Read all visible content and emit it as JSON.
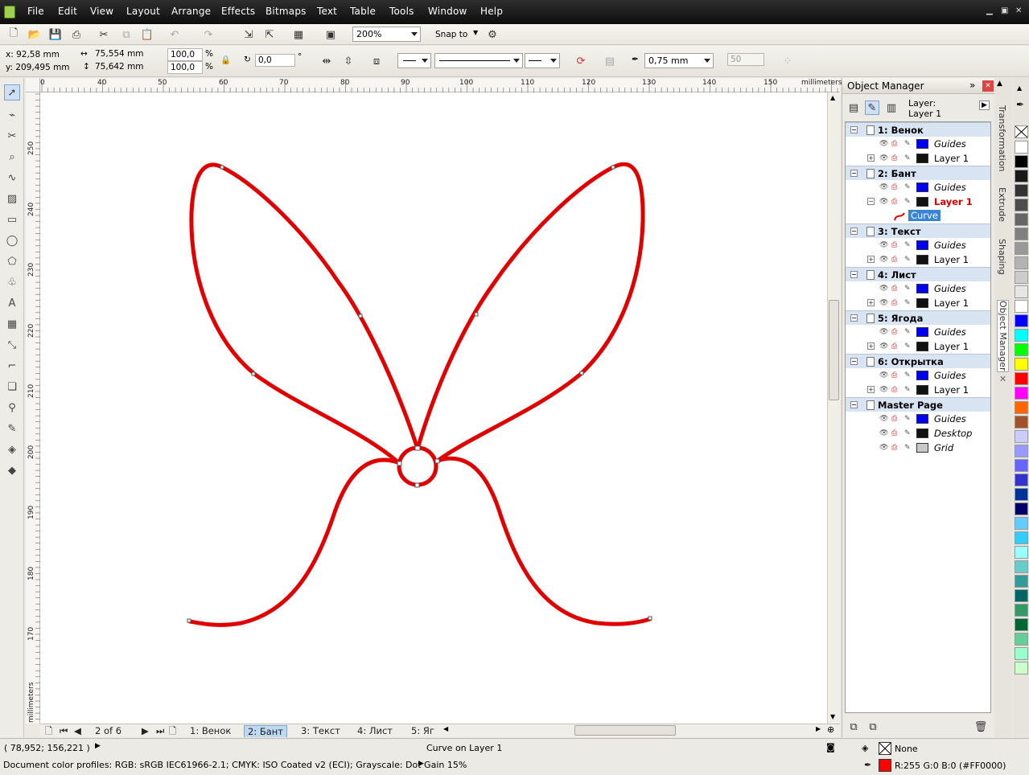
{
  "menu": [
    "File",
    "Edit",
    "View",
    "Layout",
    "Arrange",
    "Effects",
    "Bitmaps",
    "Text",
    "Table",
    "Tools",
    "Window",
    "Help"
  ],
  "toolbar": {
    "zoom": "200%",
    "snap_to": "Snap to"
  },
  "props": {
    "x": "x: 92,58 mm",
    "y": "y: 209,495 mm",
    "w": "75,554 mm",
    "h": "75,642 mm",
    "sx": "100,0",
    "sy": "100,0",
    "pct": "%",
    "angle": "0,0",
    "deg": "°",
    "outline": "0,75 mm",
    "nodes": "50"
  },
  "ruler": {
    "unit": "millimeters",
    "h": [
      "0",
      "40",
      "50",
      "60",
      "70",
      "80",
      "90",
      "100",
      "110",
      "120",
      "130",
      "140",
      "150"
    ],
    "v": [
      "250",
      "240",
      "230",
      "220",
      "210",
      "200",
      "190",
      "180",
      "170"
    ]
  },
  "pages": {
    "counter": "2 of 6",
    "tabs": [
      "1: Венок",
      "2: Бант",
      "3: Текст",
      "4: Лист",
      "5: Яг"
    ]
  },
  "docker": {
    "title": "Object Manager",
    "layer_label": "Layer:",
    "layer_value": "Layer 1",
    "rows": [
      {
        "type": "page",
        "label": "1: Венок"
      },
      {
        "type": "layer",
        "label": "Guides",
        "color": "#0000ee",
        "italic": true
      },
      {
        "type": "layer",
        "label": "Layer 1",
        "color": "#111111",
        "italic": false,
        "plus": true
      },
      {
        "type": "page",
        "label": "2: Бант"
      },
      {
        "type": "layer",
        "label": "Guides",
        "color": "#0000ee",
        "italic": true
      },
      {
        "type": "layer",
        "label": "Layer 1",
        "color": "#111111",
        "italic": false,
        "active": true
      },
      {
        "type": "object",
        "label": "Curve"
      },
      {
        "type": "page",
        "label": "3: Текст"
      },
      {
        "type": "layer",
        "label": "Guides",
        "color": "#0000ee",
        "italic": true
      },
      {
        "type": "layer",
        "label": "Layer 1",
        "color": "#111111",
        "italic": false,
        "plus": true
      },
      {
        "type": "page",
        "label": "4: Лист"
      },
      {
        "type": "layer",
        "label": "Guides",
        "color": "#0000ee",
        "italic": true
      },
      {
        "type": "layer",
        "label": "Layer 1",
        "color": "#111111",
        "italic": false,
        "plus": true
      },
      {
        "type": "page",
        "label": "5: Ягода"
      },
      {
        "type": "layer",
        "label": "Guides",
        "color": "#0000ee",
        "italic": true
      },
      {
        "type": "layer",
        "label": "Layer 1",
        "color": "#111111",
        "italic": false,
        "plus": true
      },
      {
        "type": "page",
        "label": "6: Открытка"
      },
      {
        "type": "layer",
        "label": "Guides",
        "color": "#0000ee",
        "italic": true
      },
      {
        "type": "layer",
        "label": "Layer 1",
        "color": "#111111",
        "italic": false,
        "plus": true
      },
      {
        "type": "page",
        "label": "Master Page"
      },
      {
        "type": "layer",
        "label": "Guides",
        "color": "#0000ee",
        "italic": true
      },
      {
        "type": "layer",
        "label": "Desktop",
        "color": "#111111",
        "italic": true
      },
      {
        "type": "layer",
        "label": "Grid",
        "color": "#c8c8c8",
        "italic": true
      }
    ]
  },
  "side_tabs": [
    "Transformation",
    "Extrude",
    "Shaping",
    "Object Manager"
  ],
  "palette": [
    "#ffffff",
    "#000000",
    "#1a1a1a",
    "#333333",
    "#4d4d4d",
    "#666666",
    "#808080",
    "#999999",
    "#b3b3b3",
    "#cccccc",
    "#e6e6e6",
    "#ffffff",
    "#0000ff",
    "#00ffff",
    "#00ff00",
    "#ffff00",
    "#ff0000",
    "#ff00ff",
    "#ff6600",
    "#a0522d",
    "#ccccff",
    "#9999ff",
    "#6666ff",
    "#3333cc",
    "#003399",
    "#000066",
    "#66ccff",
    "#33ccff",
    "#99ffff",
    "#66cccc",
    "#339999",
    "#006666",
    "#339966",
    "#006633",
    "#66cc99",
    "#99ffcc",
    "#ccffcc"
  ],
  "status": {
    "coords": "( 78,952; 156,221 )",
    "object_info": "Curve on Layer 1",
    "profiles": "Document color profiles: RGB: sRGB IEC61966-2.1; CMYK: ISO Coated v2 (ECI); Grayscale: Dot Gain 15%",
    "fill": "None",
    "outline_color": "R:255 G:0 B:0 (#FF0000)",
    "outline_hex": "#ff0000"
  },
  "drawing": {
    "stroke": "#e00000"
  }
}
